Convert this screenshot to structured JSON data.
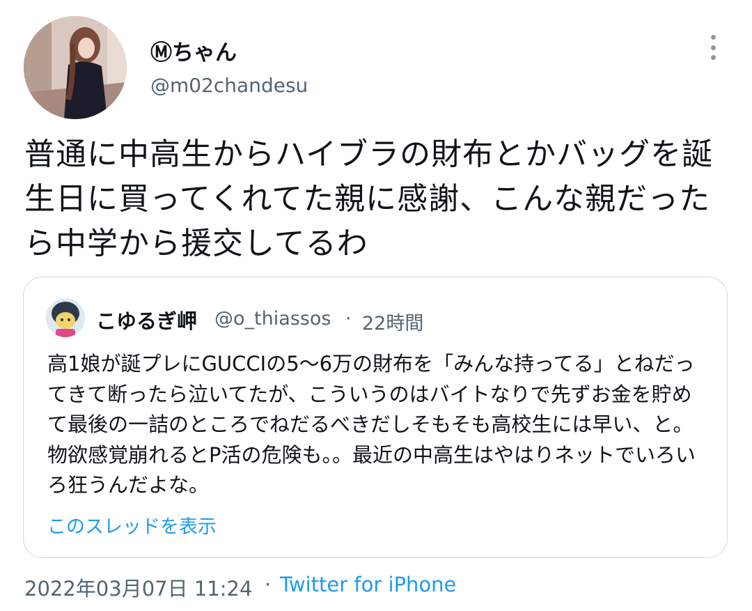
{
  "author": {
    "display_name": "Ⓜちゃん",
    "handle": "@m02chandesu"
  },
  "tweet": {
    "text": "普通に中高生からハイブラの財布とかバッグを誕生日に買ってくれてた親に感謝、こんな親だったら中学から援交してるわ",
    "timestamp": "2022年03月07日 11:24",
    "separator": "·",
    "source": "Twitter for iPhone"
  },
  "quoted_tweet": {
    "display_name": "こゆるぎ岬",
    "handle": "@o_thiassos",
    "separator": "·",
    "relative_time": "22時間",
    "text": "高1娘が誕プレにGUCCIの5〜6万の財布を「みんな持ってる」とねだってきて断ったら泣いてたが、こういうのはバイトなりで先ずお金を貯めて最後の一詰のところでねだるべきだしそもそも高校生には早い、と。物欲感覚崩れるとP活の危険も。。最近の中高生はやはりネットでいろいろ狂うんだよな。",
    "show_thread_label": "このスレッドを表示"
  },
  "icons": {
    "more": "more-vertical-icon"
  },
  "colors": {
    "link": "#1d9bf0",
    "secondary_text": "#536471",
    "border": "#cfd9de"
  }
}
